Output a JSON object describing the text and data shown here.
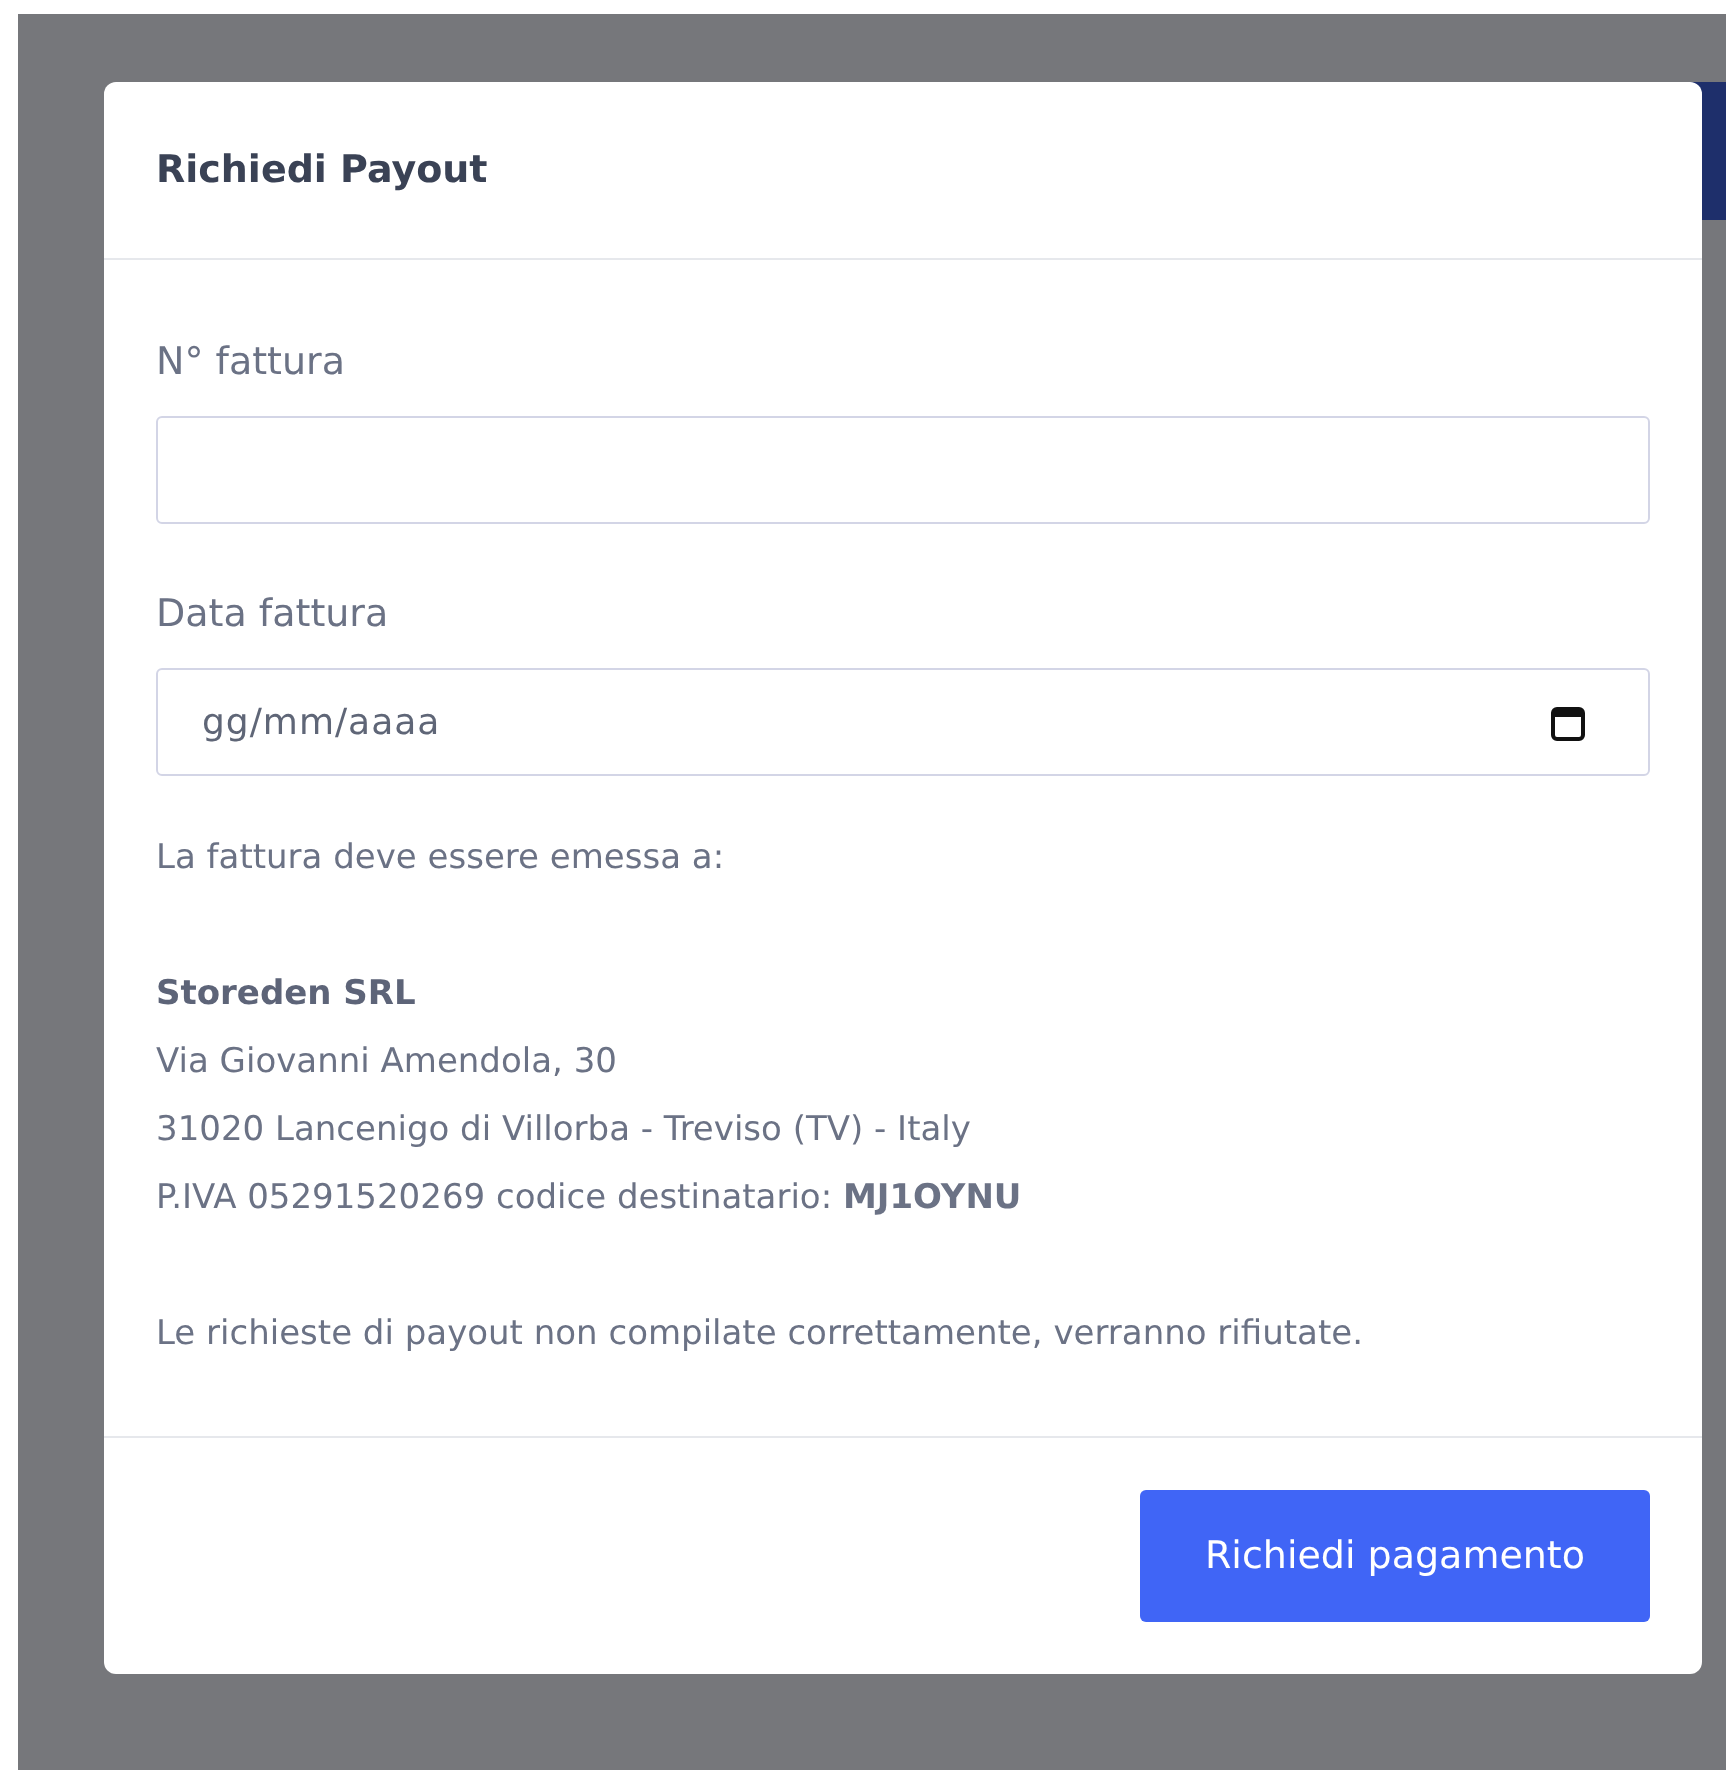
{
  "modal": {
    "title": "Richiedi Payout",
    "fields": [
      {
        "kind": "text",
        "label": "N° fattura"
      },
      {
        "kind": "date",
        "label": "Data fattura",
        "placeholder": "gg/mm/aaaa"
      }
    ],
    "intro": "La fattura deve essere emessa a:",
    "company": "Storeden SRL",
    "address_lines": [
      "Via Giovanni Amendola, 30",
      "31020 Lancenigo di Villorba - Treviso (TV) - Italy",
      "P.IVA 05291520269 codice destinatario: **MJ1OYNU**"
    ],
    "warning": "Le richieste di payout non compilate correttamente, verranno rifiutate.",
    "submit_button": "Richiedi pagamento"
  }
}
